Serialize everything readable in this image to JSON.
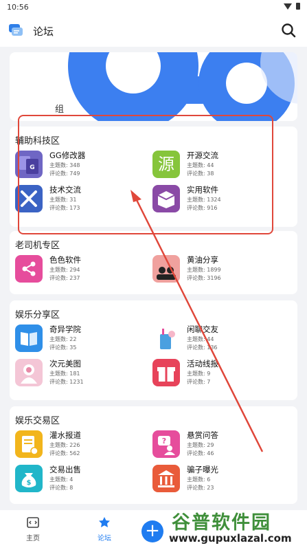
{
  "status": {
    "time": "10:56"
  },
  "appbar": {
    "title": "论坛"
  },
  "banner": {
    "tag": "组"
  },
  "sections": [
    {
      "title": "辅助科技区",
      "items": [
        {
          "name": "GG修改器",
          "topics": "主题数: 348",
          "comments": "评论数: 749",
          "icon": "gg-icon",
          "color": "#6f66c4"
        },
        {
          "name": "开源交流",
          "topics": "主题数: 44",
          "comments": "评论数: 38",
          "icon": "yuan-icon",
          "color": "#86c53b",
          "glyph": "源"
        },
        {
          "name": "技术交流",
          "topics": "主题数: 31",
          "comments": "评论数: 173",
          "icon": "tools-icon",
          "color": "#3b63c4"
        },
        {
          "name": "实用软件",
          "topics": "主题数: 1324",
          "comments": "评论数: 916",
          "icon": "box-icon",
          "color": "#8a4aa6"
        }
      ]
    },
    {
      "title": "老司机专区",
      "items": [
        {
          "name": "色色软件",
          "topics": "主题数: 294",
          "comments": "评论数: 237",
          "icon": "share-icon",
          "color": "#e64d9c"
        },
        {
          "name": "黄油分享",
          "topics": "主题数: 1899",
          "comments": "评论数: 3196",
          "icon": "group-icon",
          "color": "#f0a19e"
        }
      ]
    },
    {
      "title": "娱乐分享区",
      "items": [
        {
          "name": "奇异学院",
          "topics": "主题数: 22",
          "comments": "评论数: 35",
          "icon": "book-icon",
          "color": "#2f8fe8"
        },
        {
          "name": "闲聊交友",
          "topics": "主题数: 44",
          "comments": "评论数: 136",
          "icon": "drink-icon",
          "color": "#4aa0e0"
        },
        {
          "name": "次元美图",
          "topics": "主题数: 181",
          "comments": "评论数: 1231",
          "icon": "anime-icon",
          "color": "#e88aa8"
        },
        {
          "name": "活动线报",
          "topics": "主题数: 9",
          "comments": "评论数: 7",
          "icon": "gift-icon",
          "color": "#e7435a"
        }
      ]
    },
    {
      "title": "娱乐交易区",
      "items": [
        {
          "name": "灌水报道",
          "topics": "主题数: 226",
          "comments": "评论数: 562",
          "icon": "note-icon",
          "color": "#f2b51c"
        },
        {
          "name": "悬赏问答",
          "topics": "主题数: 29",
          "comments": "评论数: 46",
          "icon": "question-icon",
          "color": "#e64d9c"
        },
        {
          "name": "交易出售",
          "topics": "主题数: 4",
          "comments": "评论数: 8",
          "icon": "money-icon",
          "color": "#21b6c9"
        },
        {
          "name": "骗子曝光",
          "topics": "主题数: 6",
          "comments": "评论数: 23",
          "icon": "bank-icon",
          "color": "#e95b3a"
        }
      ]
    }
  ],
  "nav": {
    "home": "主页",
    "forum": "论坛",
    "fab": "+"
  },
  "watermark": {
    "brand": "谷普软件园",
    "url": "www.gupuxlazal.com"
  }
}
